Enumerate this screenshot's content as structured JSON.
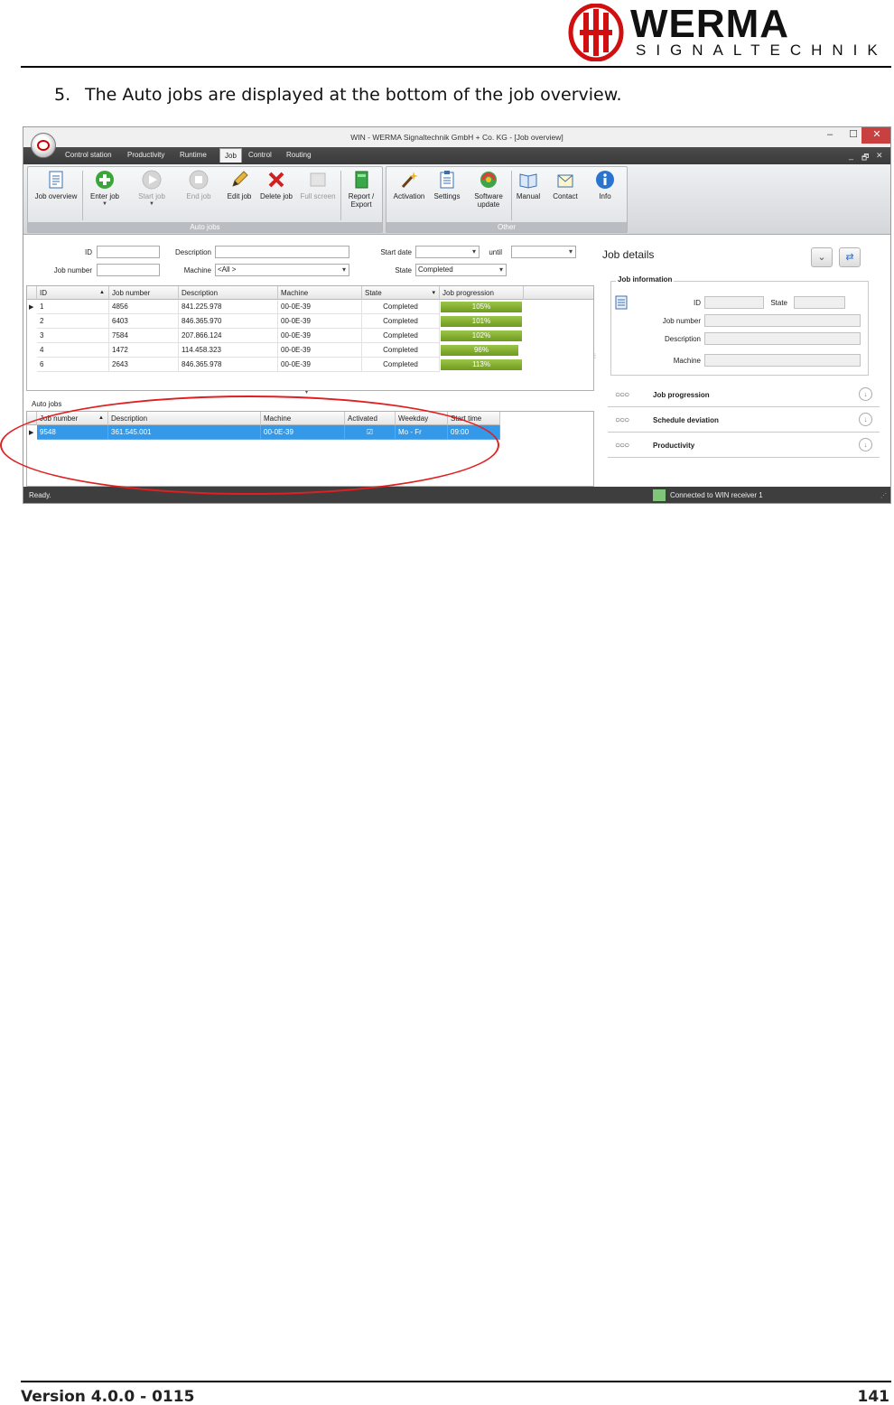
{
  "brand": {
    "name": "WERMA",
    "tagline": "SIGNALTECHNIK"
  },
  "doc": {
    "step_number": "5.",
    "step_text": "The Auto jobs are displayed at the bottom of the job overview.",
    "footer_version": "Version 4.0.0 - 0115",
    "footer_page": "141"
  },
  "window": {
    "title": "WIN - WERMA Signaltechnik GmbH + Co. KG - [Job overview]",
    "controls": {
      "minimize": "–",
      "maximize": "☐",
      "close": "✕"
    },
    "mdi_controls": {
      "minimize": "_",
      "restore": "🗗",
      "close": "✕"
    }
  },
  "menu": {
    "tabs": [
      "Control station",
      "Productivity",
      "Runtime",
      "Job",
      "Control",
      "Routing"
    ],
    "active": "Job"
  },
  "ribbon": {
    "group_auto_jobs": "Auto jobs",
    "group_other": "Other",
    "buttons": {
      "job_overview": "Job overview",
      "enter_job": "Enter job",
      "start_job": "Start job",
      "end_job": "End job",
      "edit_job": "Edit job",
      "delete_job": "Delete job",
      "full_screen": "Full screen",
      "report_export_1": "Report /",
      "report_export_2": "Export",
      "activation": "Activation",
      "settings": "Settings",
      "software_update_1": "Software",
      "software_update_2": "update",
      "manual": "Manual",
      "contact": "Contact",
      "info": "Info"
    }
  },
  "filters": {
    "id_label": "ID",
    "job_number_label": "Job number",
    "description_label": "Description",
    "machine_label": "Machine",
    "machine_value": "<All >",
    "start_date_label": "Start date",
    "until_label": "until",
    "state_label": "State",
    "state_value": "Completed"
  },
  "jobs_grid": {
    "columns": [
      "ID",
      "Job number",
      "Description",
      "Machine",
      "State",
      "Job progression"
    ],
    "rows": [
      {
        "id": "1",
        "job_number": "4856",
        "description": "841.225.978",
        "machine": "00-0E-39",
        "state": "Completed",
        "progress": "105%",
        "fill": 1.0
      },
      {
        "id": "2",
        "job_number": "6403",
        "description": "846.365.970",
        "machine": "00-0E-39",
        "state": "Completed",
        "progress": "101%",
        "fill": 1.0
      },
      {
        "id": "3",
        "job_number": "7584",
        "description": "207.866.124",
        "machine": "00-0E-39",
        "state": "Completed",
        "progress": "102%",
        "fill": 1.0
      },
      {
        "id": "4",
        "job_number": "1472",
        "description": "114.458.323",
        "machine": "00-0E-39",
        "state": "Completed",
        "progress": "96%",
        "fill": 0.96
      },
      {
        "id": "6",
        "job_number": "2643",
        "description": "846.365.978",
        "machine": "00-0E-39",
        "state": "Completed",
        "progress": "113%",
        "fill": 1.0
      }
    ]
  },
  "auto_jobs": {
    "title": "Auto jobs",
    "columns": [
      "Job number",
      "Description",
      "Machine",
      "Activated",
      "Weekday",
      "Start time"
    ],
    "rows": [
      {
        "job_number": "9548",
        "description": "361.545.001",
        "machine": "00-0E-39",
        "activated": "☑",
        "weekday": "Mo - Fr",
        "start_time": "09:00"
      }
    ]
  },
  "details": {
    "title": "Job details",
    "info_legend": "Job information",
    "id_label": "ID",
    "state_label": "State",
    "job_number_label": "Job number",
    "description_label": "Description",
    "machine_label": "Machine",
    "sections": [
      "Job progression",
      "Schedule deviation",
      "Productivity"
    ]
  },
  "status": {
    "left": "Ready.",
    "connection": "Connected to WIN receiver 1"
  },
  "colors": {
    "accent_red": "#e02020",
    "progress_green": "#7aa62a",
    "selection_blue": "#3399e8",
    "connected_green": "#7fc67a"
  }
}
